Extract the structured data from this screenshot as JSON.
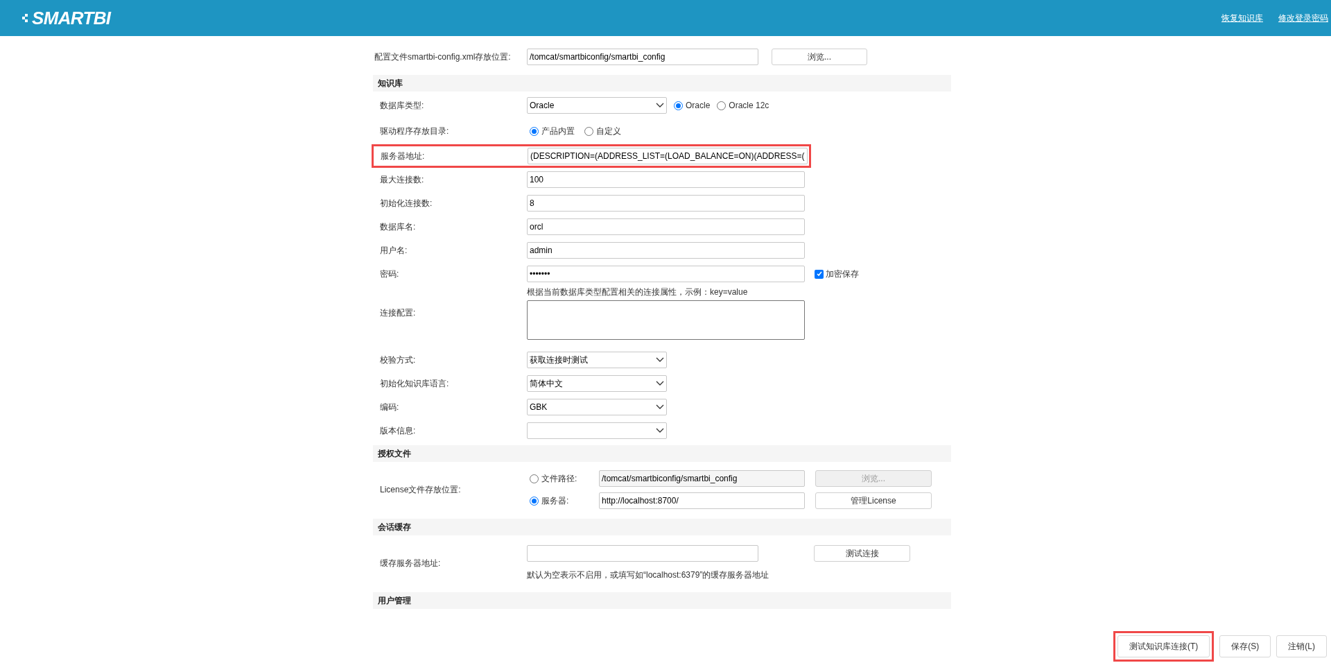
{
  "header": {
    "logo": "SMARTBI",
    "links": [
      "恢复知识库",
      "修改登录密码"
    ]
  },
  "config_path": {
    "label": "配置文件smartbi-config.xml存放位置:",
    "value": "/tomcat/smartbiconfig/smartbi_config",
    "button": "浏览..."
  },
  "sections": [
    {
      "title": "知识库",
      "rows": [
        {
          "kind": "select_radio",
          "label": "数据库类型:",
          "value": "Oracle",
          "options": [
            {
              "label": "Oracle",
              "selected": true
            },
            {
              "label": "Oracle 12c",
              "selected": false
            }
          ]
        },
        {
          "kind": "radio",
          "label": "驱动程序存放目录:",
          "options": [
            {
              "label": "产品内置",
              "selected": true
            },
            {
              "label": "自定义",
              "selected": false
            }
          ]
        },
        {
          "kind": "text",
          "label": "服务器地址:",
          "value": "(DESCRIPTION=(ADDRESS_LIST=(LOAD_BALANCE=ON)(ADDRESS=(",
          "highlighted": true
        },
        {
          "kind": "text",
          "label": "最大连接数:",
          "value": "100",
          "highlighted": false
        },
        {
          "kind": "text",
          "label": "初始化连接数:",
          "value": "8",
          "highlighted": false
        },
        {
          "kind": "text",
          "label": "数据库名:",
          "value": "orcl",
          "highlighted": false
        },
        {
          "kind": "text",
          "label": "用户名:",
          "value": "admin",
          "highlighted": false
        },
        {
          "kind": "password",
          "label": "密码:",
          "value": "•••••••",
          "check": {
            "label": "加密保存",
            "checked": true
          }
        },
        {
          "kind": "textarea",
          "label": "连接配置:",
          "hint": "根据当前数据库类型配置相关的连接属性，示例：key=value"
        },
        {
          "kind": "select",
          "label": "校验方式:",
          "value": "获取连接时测试"
        },
        {
          "kind": "select",
          "label": "初始化知识库语言:",
          "value": "简体中文"
        },
        {
          "kind": "select",
          "label": "编码:",
          "value": "GBK"
        },
        {
          "kind": "select",
          "label": "版本信息:"
        }
      ]
    },
    {
      "title": "授权文件",
      "rows": [
        {
          "kind": "license",
          "label": "License文件存放位置:",
          "options": [
            {
              "label": "文件路径:",
              "value": "/tomcat/smartbiconfig/smartbi_config",
              "button": "浏览...",
              "selected": false
            },
            {
              "label": "服务器:",
              "value": "http://localhost:8700/",
              "button": "管理License",
              "selected": true
            }
          ]
        }
      ]
    },
    {
      "title": "会话缓存",
      "rows": [
        {
          "kind": "cache",
          "label": "缓存服务器地址:",
          "button": "测试连接",
          "hint": "默认为空表示不启用，或填写如“localhost:6379”的缓存服务器地址"
        }
      ]
    },
    {
      "title": "用户管理"
    }
  ],
  "footer_buttons": [
    {
      "label": "测试知识库连接(T)",
      "highlighted": true
    },
    {
      "label": "保存(S)",
      "highlighted": false
    },
    {
      "label": "注销(L)",
      "highlighted": false
    }
  ]
}
